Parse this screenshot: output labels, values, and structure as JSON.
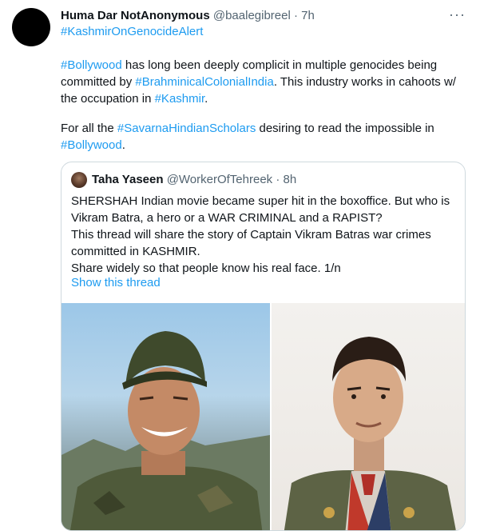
{
  "tweet": {
    "display_name": "Huma Dar NotAnonymous",
    "handle": "@baalegibreel",
    "separator": "·",
    "time": "7h",
    "more": "···",
    "hashtag_top": "#KashmirOnGenocideAlert",
    "p1": {
      "tag1": "#Bollywood",
      "text1": " has long been deeply complicit in multiple genocides being",
      "text2": "committed by ",
      "tag2": "#BrahminicalColonialIndia",
      "text3": ". This industry works in cahoots w/",
      "text4": "the occupation in ",
      "tag3": "#Kashmir",
      "text5": "."
    },
    "p2": {
      "text1": "For all the ",
      "tag1": "#SavarnaHindianScholars",
      "text2": " desiring to read the impossible in",
      "tag2": "#Bollywood",
      "text3": "."
    }
  },
  "quoted": {
    "display_name": "Taha Yaseen",
    "handle": "@WorkerOfTehreek",
    "separator": "·",
    "time": "8h",
    "lines": [
      "SHERSHAH Indian movie became super hit in the boxoffice. But who is",
      "Vikram Batra, a hero or a WAR CRIMINAL and a RAPIST?",
      "This thread will share the story of Captain Vikram Batras war crimes",
      "committed in KASHMIR.",
      "Share widely so that people know his real face. 1/n"
    ],
    "show_thread": "Show this thread"
  }
}
